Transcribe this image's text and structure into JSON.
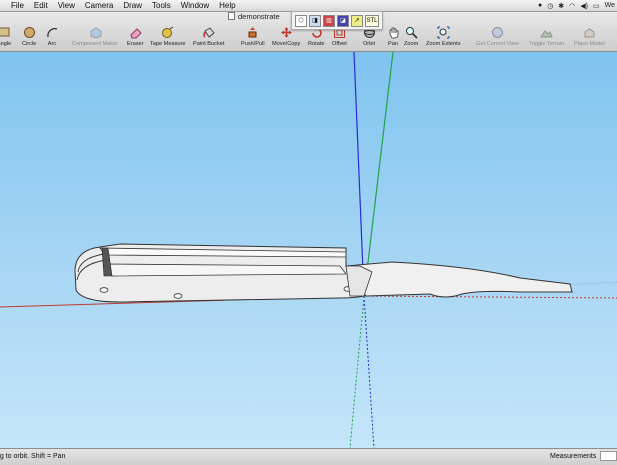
{
  "menubar": {
    "items": [
      "File",
      "Edit",
      "View",
      "Camera",
      "Draw",
      "Tools",
      "Window",
      "Help"
    ],
    "clock": "We"
  },
  "window": {
    "title": "demonstrate"
  },
  "toolbar": {
    "tools": [
      {
        "label": "tangle",
        "icon": "rectangle-icon",
        "enabled": true
      },
      {
        "label": "Circle",
        "icon": "circle-icon",
        "enabled": true
      },
      {
        "label": "Arc",
        "icon": "arc-icon",
        "enabled": true
      },
      {
        "label": "Component Maker",
        "icon": "component-maker-icon",
        "enabled": false
      },
      {
        "label": "Eraser",
        "icon": "eraser-icon",
        "enabled": true
      },
      {
        "label": "Tape Measure",
        "icon": "tape-measure-icon",
        "enabled": true
      },
      {
        "label": "Paint Bucket",
        "icon": "paint-bucket-icon",
        "enabled": true
      },
      {
        "label": "Push/Pull",
        "icon": "push-pull-icon",
        "enabled": true
      },
      {
        "label": "Move/Copy",
        "icon": "move-copy-icon",
        "enabled": true
      },
      {
        "label": "Rotate",
        "icon": "rotate-icon",
        "enabled": true
      },
      {
        "label": "Offset",
        "icon": "offset-icon",
        "enabled": true
      },
      {
        "label": "Orbit",
        "icon": "orbit-icon",
        "enabled": true
      },
      {
        "label": "Pan",
        "icon": "pan-icon",
        "enabled": true
      },
      {
        "label": "Zoom",
        "icon": "zoom-icon",
        "enabled": true
      },
      {
        "label": "Zoom Extents",
        "icon": "zoom-extents-icon",
        "enabled": true
      },
      {
        "label": "Get Current View",
        "icon": "get-current-view-icon",
        "enabled": false
      },
      {
        "label": "Toggle Terrain",
        "icon": "toggle-terrain-icon",
        "enabled": false
      },
      {
        "label": "Place Model",
        "icon": "place-model-icon",
        "enabled": false
      }
    ]
  },
  "floating_toolbar": {
    "stl_label": "STL"
  },
  "statusbar": {
    "hint": "ag to orbit.  Shift = Pan",
    "measurements_label": "Measurements",
    "measurements_value": ""
  },
  "colors": {
    "sky": "#7fc3ef",
    "axis_blue": "#2b2bd6",
    "axis_green": "#1fa34a",
    "axis_red": "#c0392b",
    "model_face": "#ededed"
  }
}
